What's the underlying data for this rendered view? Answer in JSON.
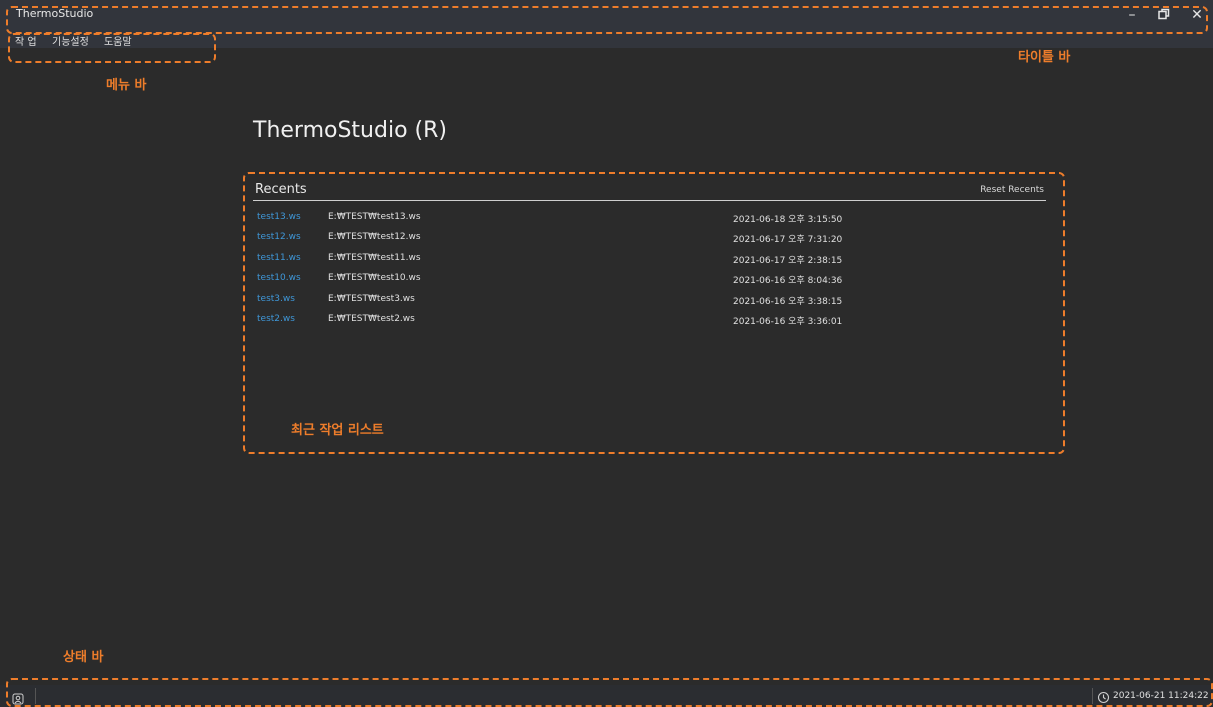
{
  "window": {
    "title": "ThermoStudio",
    "minimize_symbol": "–",
    "close_symbol": "✕"
  },
  "menu": [
    {
      "label": "작 업"
    },
    {
      "label": "기능설정"
    },
    {
      "label": "도움말"
    }
  ],
  "main": {
    "heading": "ThermoStudio (R)",
    "recents": {
      "title": "Recents",
      "reset_label": "Reset Recents",
      "items": [
        {
          "name": "test13.ws",
          "path": "E:₩TEST₩test13.ws",
          "date": "2021-06-18 오후 3:15:50"
        },
        {
          "name": "test12.ws",
          "path": "E:₩TEST₩test12.ws",
          "date": "2021-06-17 오후 7:31:20"
        },
        {
          "name": "test11.ws",
          "path": "E:₩TEST₩test11.ws",
          "date": "2021-06-17 오후 2:38:15"
        },
        {
          "name": "test10.ws",
          "path": "E:₩TEST₩test10.ws",
          "date": "2021-06-16 오후 8:04:36"
        },
        {
          "name": "test3.ws",
          "path": "E:₩TEST₩test3.ws",
          "date": "2021-06-16 오후 3:38:15"
        },
        {
          "name": "test2.ws",
          "path": "E:₩TEST₩test2.ws",
          "date": "2021-06-16 오후 3:36:01"
        }
      ]
    }
  },
  "status": {
    "datetime": "2021-06-21 11:24:22"
  },
  "annotations": {
    "title_bar": "타이틀 바",
    "menu_bar": "메뉴 바",
    "recent_list": "최근 작업 리스트",
    "status_bar": "상태 바"
  },
  "colors": {
    "accent_annotation": "#ee7d2b",
    "link": "#3f97d8",
    "background": "#2b2b2b",
    "titlebar": "#32353c"
  },
  "icons": {
    "maximize": "restore-icon",
    "status_left": "shield-user-icon",
    "status_right": "clock-icon"
  }
}
